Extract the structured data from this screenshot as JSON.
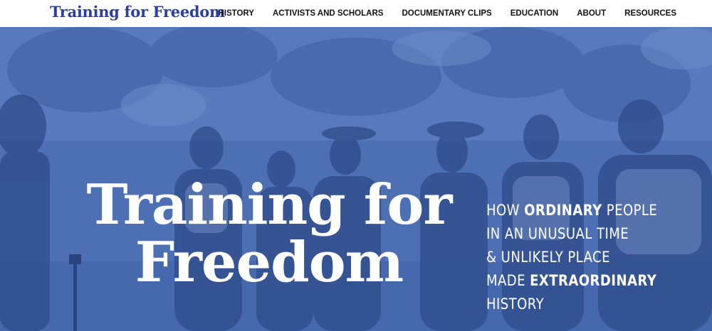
{
  "header": {
    "site_title": "Training for Freedom",
    "nav": [
      "HISTORY",
      "ACTIVISTS AND SCHOLARS",
      "DOCUMENTARY CLIPS",
      "EDUCATION",
      "ABOUT",
      "RESOURCES"
    ]
  },
  "hero": {
    "title_line1": "Training for",
    "title_line2": "Freedom",
    "tagline": {
      "l1_a": "HOW ",
      "l1_b": "ORDINARY",
      "l1_c": " PEOPLE",
      "l2": "IN AN UNUSUAL TIME",
      "l3": "& UNLIKELY PLACE",
      "l4_a": "MADE ",
      "l4_b": "EXTRAORDINARY",
      "l5": "HISTORY"
    },
    "overlay_color": "#4d6fb3"
  },
  "colors": {
    "brand": "#2a3fa0",
    "nav_text": "#111111",
    "hero_text": "#ffffff"
  }
}
